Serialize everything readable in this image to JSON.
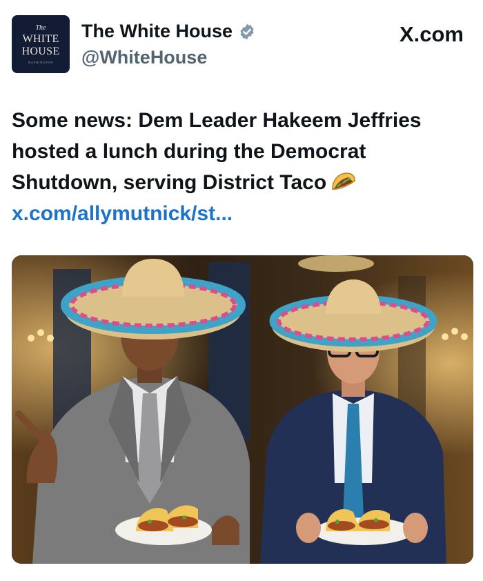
{
  "account": {
    "avatar_text": {
      "line1": "The",
      "line2": "WHITE",
      "line3": "HOUSE",
      "line4": "WASHINGTON"
    },
    "display_name": "The White House",
    "handle": "@WhiteHouse",
    "verified_icon": "verified-badge-icon"
  },
  "site": {
    "label": "X.com",
    "logo_icon": "x-logo-icon"
  },
  "post": {
    "lines": [
      "Some news: Dem Leader Hakeem Jeffries",
      "hosted a lunch during the Democrat",
      "Shutdown, serving District Taco"
    ],
    "emoji_icon": "taco-emoji-icon",
    "link": "x.com/allymutnick/st..."
  },
  "media": {
    "icon": "photo-two-men-sombreros-tacos"
  },
  "colors": {
    "link": "#1d73c8",
    "verified": "#829aab",
    "text": "#0f1419",
    "handle": "#536471"
  }
}
